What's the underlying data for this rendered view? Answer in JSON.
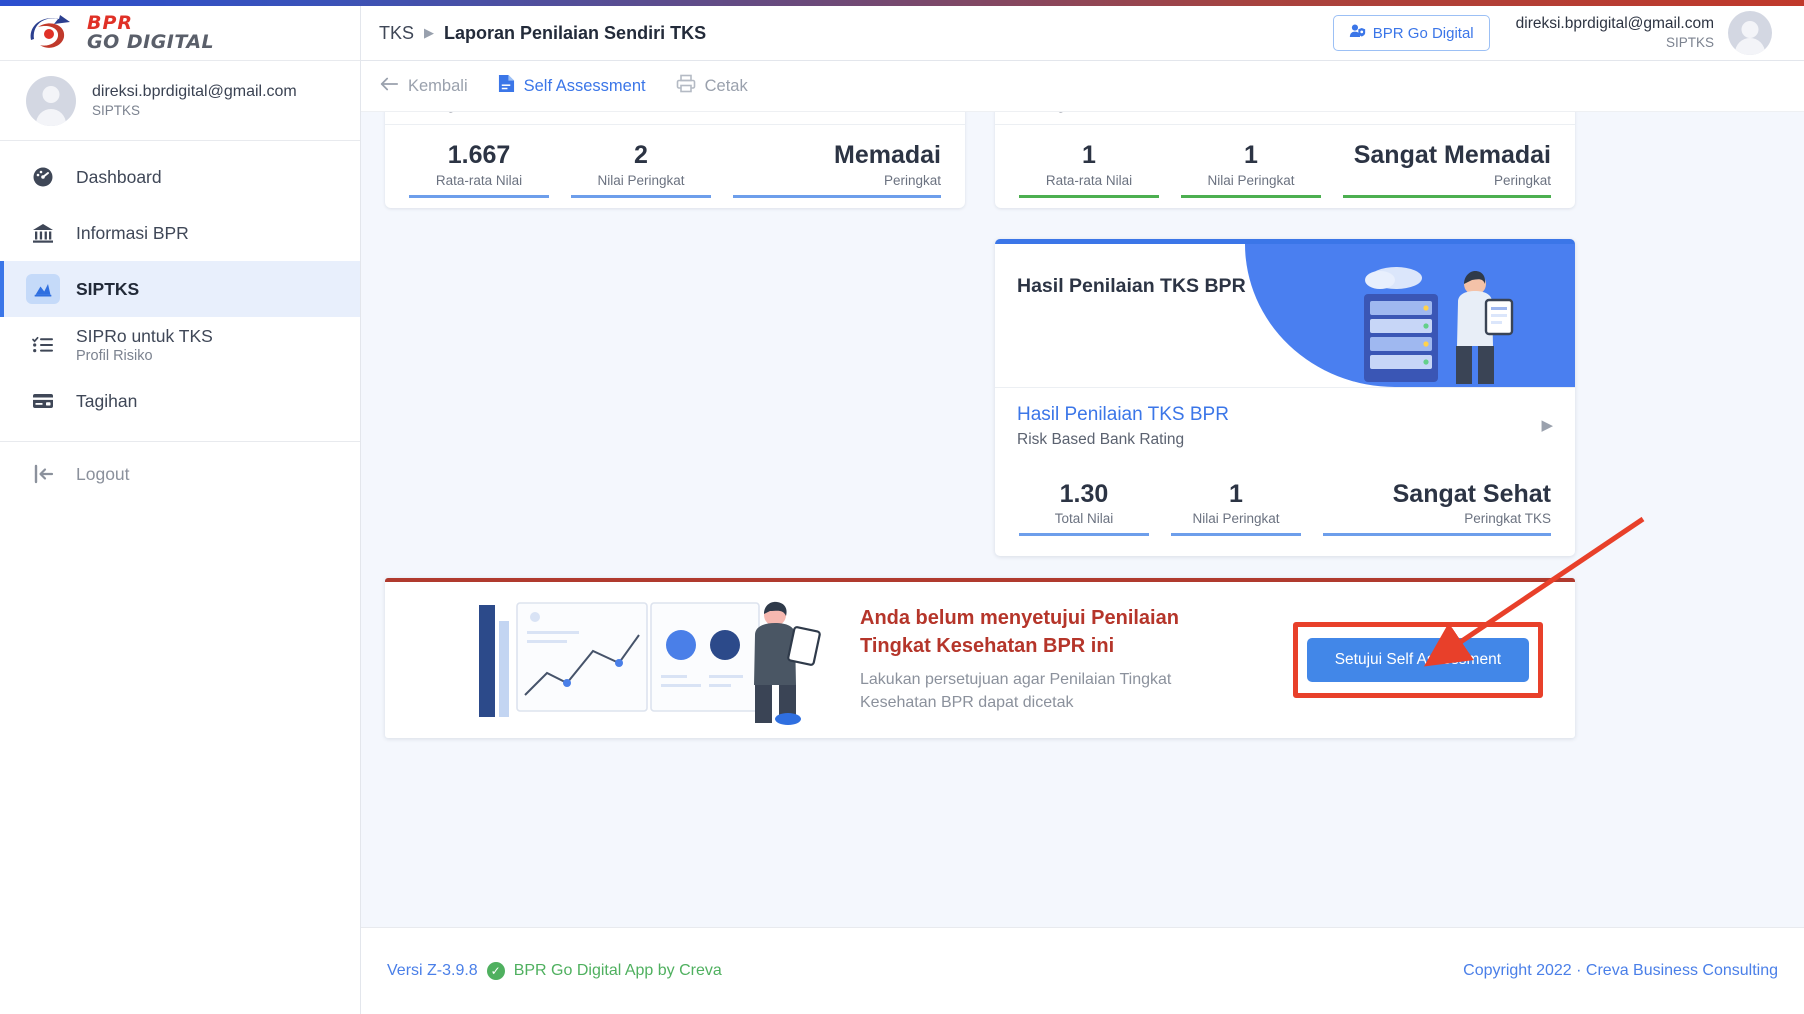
{
  "brand": {
    "bpr": "BPR",
    "go_digital": "GO DIGITAL"
  },
  "sidebar": {
    "user": {
      "email": "direksi.bprdigital@gmail.com",
      "role": "SIPTKS"
    },
    "items": [
      {
        "label": "Dashboard",
        "icon": "dashboard-icon",
        "sub": ""
      },
      {
        "label": "Informasi BPR",
        "icon": "bank-icon",
        "sub": ""
      },
      {
        "label": "SIPTKS",
        "icon": "chart-icon",
        "sub": ""
      },
      {
        "label": "SIPRo untuk TKS",
        "icon": "checklist-icon",
        "sub": "Profil Risiko"
      },
      {
        "label": "Tagihan",
        "icon": "card-icon",
        "sub": ""
      }
    ],
    "logout": {
      "label": "Logout",
      "icon": "logout-icon"
    }
  },
  "header": {
    "breadcrumb_root": "TKS",
    "breadcrumb_sep": "▶",
    "breadcrumb_current": "Laporan Penilaian Sendiri TKS",
    "go_digital_button": "BPR Go Digital",
    "user_email": "direksi.bprdigital@gmail.com",
    "user_role": "SIPTKS"
  },
  "toolbar": {
    "back_label": "Kembali",
    "self_assessment_label": "Self Assessment",
    "print_label": "Cetak"
  },
  "stat_cards": [
    {
      "title": "Peringkat Rentabilitas",
      "accent": "#6d9eeb",
      "cells": [
        {
          "value": "1.667",
          "label": "Rata-rata Nilai"
        },
        {
          "value": "2",
          "label": "Nilai Peringkat"
        },
        {
          "value": "Memadai",
          "label": "Peringkat"
        }
      ]
    },
    {
      "title": "Peringkat Permodalan",
      "accent": "#4caf50",
      "cells": [
        {
          "value": "1",
          "label": "Rata-rata Nilai"
        },
        {
          "value": "1",
          "label": "Nilai Peringkat"
        },
        {
          "value": "Sangat Memadai",
          "label": "Peringkat"
        }
      ]
    }
  ],
  "tks_card": {
    "hero_title": "Hasil Penilaian TKS BPR",
    "link_title": "Hasil Penilaian TKS BPR",
    "link_sub": "Risk Based Bank Rating",
    "chevron": "▶",
    "cells": [
      {
        "value": "1.30",
        "label": "Total Nilai"
      },
      {
        "value": "1",
        "label": "Nilai Peringkat"
      },
      {
        "value": "Sangat Sehat",
        "label": "Peringkat TKS"
      }
    ],
    "accent": "#6d9eeb"
  },
  "banner": {
    "title": "Anda belum menyetujui Penilaian Tingkat Kesehatan BPR ini",
    "description": "Lakukan persetujuan agar Penilaian Tingkat Kesehatan BPR dapat dicetak",
    "button_label": "Setujui Self Assessment"
  },
  "footer": {
    "version": "Versi Z-3.9.8",
    "app_by": "BPR Go Digital App by Creva",
    "copyright": "Copyright 2022 · Creva Business Consulting"
  },
  "colors": {
    "accent_blue": "#3b76e8",
    "warning_red": "#b5352a",
    "annotation_red": "#e8402a",
    "success_green": "#4caf50"
  }
}
